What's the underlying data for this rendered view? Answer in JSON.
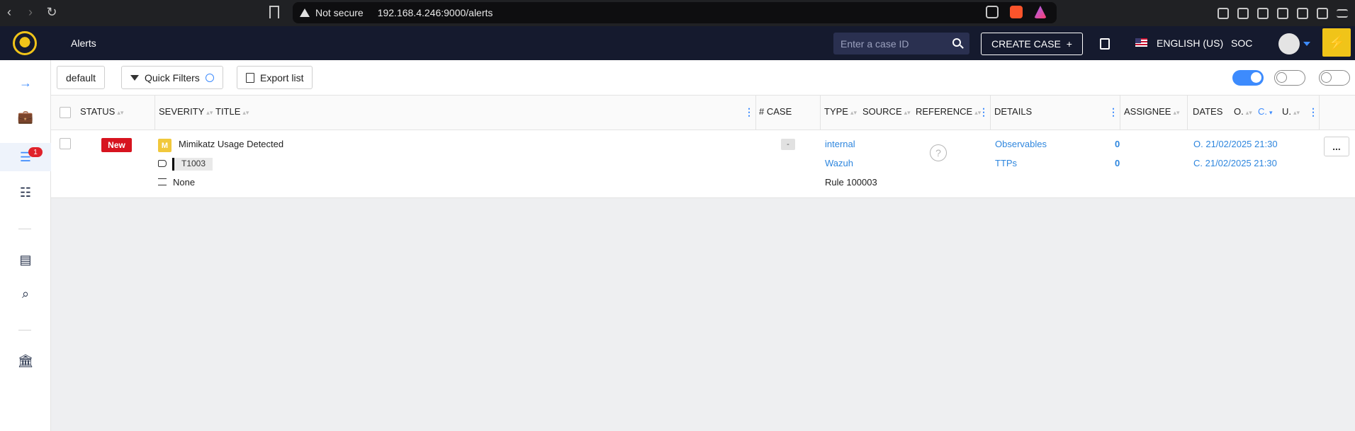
{
  "browser": {
    "security_label": "Not secure",
    "url": "192.168.4.246:9000/alerts"
  },
  "header": {
    "title": "Alerts",
    "case_search_placeholder": "Enter a case ID",
    "create_case_label": "CREATE CASE",
    "create_case_symbol": "+",
    "language": "ENGLISH (US)",
    "organisation": "SOC",
    "bolt_symbol": "⚡"
  },
  "sidebar": {
    "alerts_badge": "1",
    "items": [
      {
        "name": "expand",
        "glyph": "→"
      },
      {
        "name": "cases",
        "glyph": "💼"
      },
      {
        "name": "alerts",
        "glyph": "☰"
      },
      {
        "name": "tasks",
        "glyph": "☷"
      },
      {
        "name": "dashboards",
        "glyph": "▤"
      },
      {
        "name": "search",
        "glyph": "⌕"
      },
      {
        "name": "organisation",
        "glyph": "🏛"
      }
    ]
  },
  "toolbar": {
    "filter_preset": "default",
    "quick_filters": "Quick Filters",
    "export_list": "Export list"
  },
  "columns": {
    "status": "STATUS",
    "severity": "SEVERITY",
    "title": "TITLE",
    "case": "# CASE",
    "type": "TYPE",
    "source": "SOURCE",
    "reference": "REFERENCE",
    "details": "DETAILS",
    "assignee": "ASSIGNEE",
    "dates": "DATES",
    "dates_o": "O.",
    "dates_c": "C.",
    "dates_u": "U."
  },
  "alerts": [
    {
      "status": "New",
      "severity": "M",
      "title": "Mimikatz Usage Detected",
      "tag": "T1003",
      "custom_fields": "None",
      "case": "-",
      "type": "internal",
      "source": "Wazuh",
      "reference": "Rule 100003",
      "observables_label": "Observables",
      "observables_count": "0",
      "ttps_label": "TTPs",
      "ttps_count": "0",
      "assignee_symbol": "?",
      "occurred": "O. 21/02/2025 21:30",
      "created": "C. 21/02/2025 21:30",
      "actions_symbol": "..."
    }
  ],
  "colors": {
    "header_bg": "#151a2e",
    "accent": "#3d8bfd",
    "status_new": "#d7141f",
    "severity_medium": "#f1c83c",
    "brand_yellow": "#f0c419"
  }
}
